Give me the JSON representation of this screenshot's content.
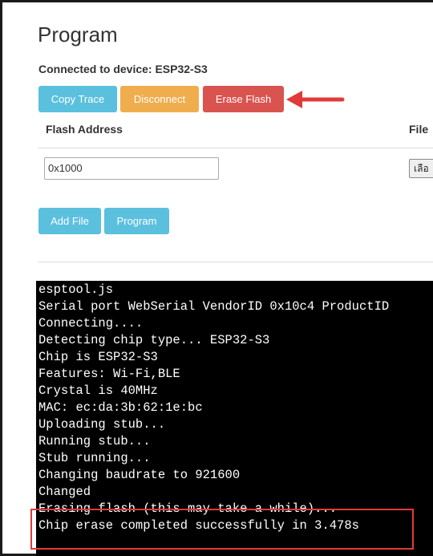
{
  "page": {
    "title": "Program"
  },
  "device": {
    "connected_text": "Connected to device: ESP32-S3"
  },
  "toolbar": {
    "copy_trace_label": "Copy Trace",
    "disconnect_label": "Disconnect",
    "erase_flash_label": "Erase Flash"
  },
  "table": {
    "col_flash_address": "Flash Address",
    "col_file": "File",
    "address_value": "0x1000",
    "file_button_label": "เลือ"
  },
  "actions": {
    "add_file_label": "Add File",
    "program_label": "Program"
  },
  "terminal": {
    "lines": [
      "esptool.js",
      "Serial port WebSerial VendorID 0x10c4 ProductID",
      "Connecting....",
      "Detecting chip type... ESP32-S3",
      "Chip is ESP32-S3",
      "Features: Wi-Fi,BLE",
      "Crystal is 40MHz",
      "MAC: ec:da:3b:62:1e:bc",
      "Uploading stub...",
      "Running stub...",
      "Stub running...",
      "Changing baudrate to 921600",
      "Changed",
      "Erasing flash (this may take a while)...",
      "Chip erase completed successfully in 3.478s"
    ]
  },
  "colors": {
    "info": "#5bc0de",
    "warning": "#f0ad4e",
    "danger": "#d9534f",
    "annotation": "#e03a3a"
  }
}
